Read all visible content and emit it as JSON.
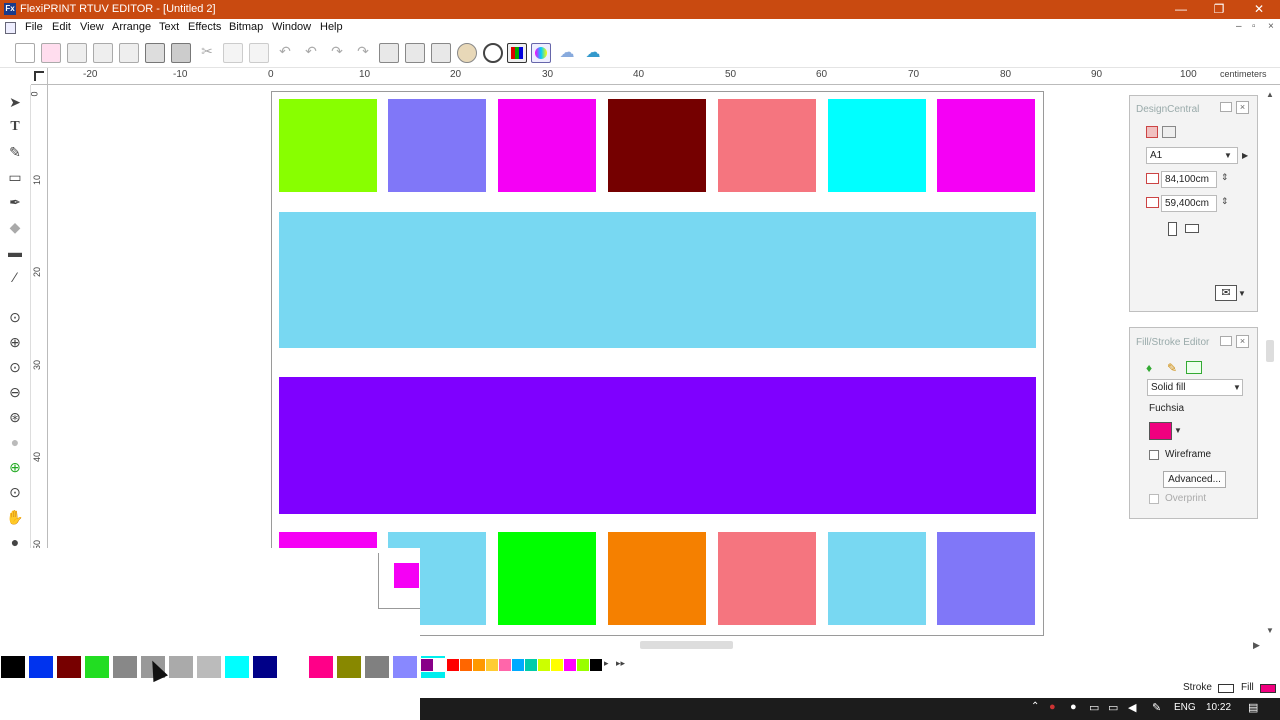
{
  "window": {
    "app_icon": "Fx",
    "title": "FlexiPRINT RTUV EDITOR - [Untitled 2]",
    "minimize": "—",
    "restore": "❐",
    "close": "✕"
  },
  "menu": [
    "File",
    "Edit",
    "View",
    "Arrange",
    "Text",
    "Effects",
    "Bitmap",
    "Window",
    "Help"
  ],
  "mdi_controls": [
    "–",
    "▫",
    "×"
  ],
  "ruler": {
    "h_labels": [
      "-20",
      "-10",
      "0",
      "10",
      "20",
      "30",
      "40",
      "50",
      "60",
      "70",
      "80",
      "90",
      "100"
    ],
    "unit": "centimeters",
    "v_labels": [
      "0",
      "10",
      "20",
      "30",
      "40",
      "50"
    ]
  },
  "canvas": {
    "top_row": [
      "#88ff00",
      "#8077f8",
      "#f500f5",
      "#750000",
      "#f5757f",
      "#00ffff",
      "#f500f5"
    ],
    "band_light": "#78d8f2",
    "band_purple": "#7f00ff",
    "bottom_row": [
      "#f500f5",
      "#78d8f2",
      "#00ff00",
      "#f58000",
      "#f5757f",
      "#78d8f2",
      "#8077f8"
    ],
    "preview_swatch": "#f500f5"
  },
  "palette": {
    "main": [
      "#000000",
      "#0033ee",
      "#770000",
      "#22dd22",
      "#888888",
      "#999999",
      "#aaaaaa",
      "#bbbbbb",
      "#00ffff",
      "#000088",
      "#ffffff",
      "#ff0088",
      "#888800",
      "#808080",
      "#8888ff",
      "#00eeee"
    ],
    "mini": [
      "#880088",
      "#ffffff",
      "#ff0000",
      "#ff6600",
      "#ff9900",
      "#ffcc33",
      "#ff66aa",
      "#00aaff",
      "#00ccaa",
      "#ccff00",
      "#ffff00",
      "#ff00ff",
      "#99ff00",
      "#000000"
    ],
    "nav": [
      "▸",
      "▸▸"
    ]
  },
  "design_central": {
    "title": "DesignCentral",
    "page_size": "A1",
    "width": "84,100cm",
    "height": "59,400cm"
  },
  "fill_stroke": {
    "title": "Fill/Stroke Editor",
    "fill_type": "Solid fill",
    "color_name": "Fuchsia",
    "color": "#f0007f",
    "wireframe_label": "Wireframe",
    "advanced_label": "Advanced...",
    "overprint_label": "Overprint"
  },
  "status": {
    "stroke_label": "Stroke",
    "fill_label": "Fill",
    "fill_color": "#f0007f"
  },
  "taskbar": {
    "lang": "ENG",
    "time": "10:22"
  }
}
